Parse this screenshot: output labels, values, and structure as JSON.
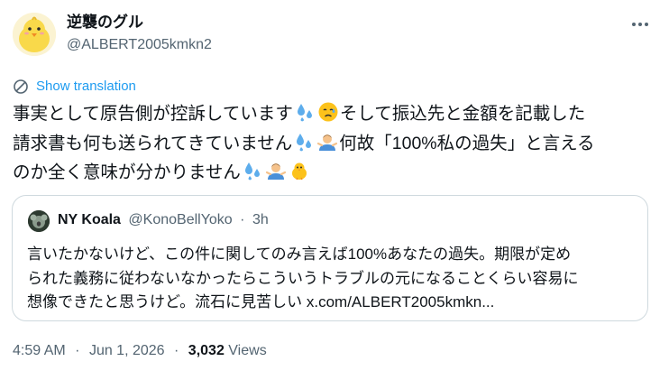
{
  "author": {
    "display_name": "逆襲のグル",
    "handle": "@ALBERT2005kmkn2",
    "avatar_icon": "chick-avatar-icon"
  },
  "more_icon": "more-horizontal-icon",
  "translation": {
    "label": "Show translation",
    "icon": "globe-translate-icon",
    "color": "#1d9bf0"
  },
  "tweet": {
    "line1_a": "事実として原告側が控訴しています",
    "line1_b": "そして振込先と金額を記載した",
    "line2_a": "請求書も何も送られてきていません",
    "line2_b": "何故「100%私の過失」と言える",
    "line3_a": "のか全く意味が分かりません",
    "emojis": [
      "sweat-droplets-icon",
      "sad-relieved-face-icon",
      "man-shrugging-icon",
      "baby-chick-icon"
    ]
  },
  "quote": {
    "name": "NY Koala",
    "handle": "@KonoBellYoko",
    "dot": "·",
    "time": "3h",
    "line1": "言いたかないけど、この件に関してのみ言えば100%あなたの過失。期限が定め",
    "line2": "られた義務に従わないなかったらこういうトラブルの元になることくらい容易に",
    "line3": "想像できたと思うけど。流石に見苦しい x.com/ALBERT2005kmkn..."
  },
  "meta": {
    "time": "4:59 AM",
    "sep1": "·",
    "date": "Jun 1, 2026",
    "sep2": "·",
    "views_count": "3,032",
    "views_label": "Views"
  },
  "colors": {
    "text": "#0f1419",
    "secondary": "#536471",
    "border": "#cfd9de",
    "accent": "#1d9bf0"
  }
}
